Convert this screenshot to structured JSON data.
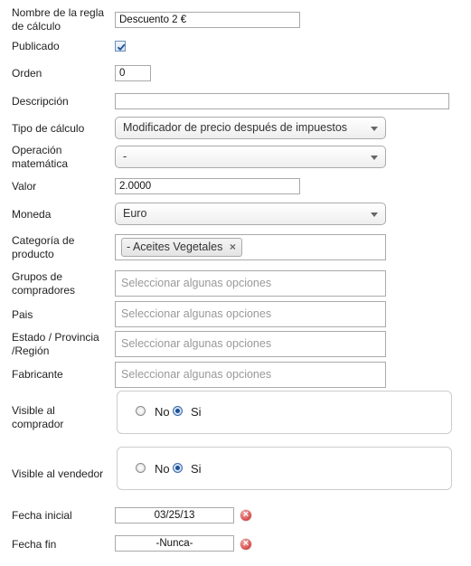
{
  "fields": {
    "nombre": {
      "label": "Nombre de la regla de cálculo",
      "value": "Descuento 2 €"
    },
    "publicado": {
      "label": "Publicado",
      "checked": true
    },
    "orden": {
      "label": "Orden",
      "value": "0"
    },
    "descripcion": {
      "label": "Descripción",
      "value": ""
    },
    "tipo_calculo": {
      "label": "Tipo de cálculo",
      "value": "Modificador de precio después de impuestos"
    },
    "operacion": {
      "label": "Operación matemática",
      "value": "-"
    },
    "valor": {
      "label": "Valor",
      "value": "2.0000"
    },
    "moneda": {
      "label": "Moneda",
      "value": "Euro"
    },
    "categoria": {
      "label": "Categoría de producto",
      "chip": "- Aceites Vegetales",
      "chip_remove": "×"
    },
    "grupos": {
      "label": "Grupos de compradores",
      "placeholder": "Seleccionar algunas opciones"
    },
    "pais": {
      "label": "Pais",
      "placeholder": "Seleccionar algunas opciones"
    },
    "estado": {
      "label": "Estado / Provincia /Región",
      "placeholder": "Seleccionar algunas opciones"
    },
    "fabricante": {
      "label": "Fabricante",
      "placeholder": "Seleccionar algunas opciones"
    },
    "visible_comprador": {
      "label": "Visible al comprador",
      "options": [
        "No",
        "Si"
      ],
      "selected": "Si"
    },
    "visible_vendedor": {
      "label": "Visible al vendedor",
      "options": [
        "No",
        "Si"
      ],
      "selected": "Si"
    },
    "fecha_inicial": {
      "label": "Fecha inicial",
      "value": "03/25/13"
    },
    "fecha_fin": {
      "label": "Fecha fin",
      "value": "-Nunca-"
    }
  },
  "icons": {
    "clear": "clear-date-icon",
    "checkbox": "checkmark-icon",
    "dropdown": "chevron-down-icon"
  },
  "colors": {
    "clear_button": "#d9534f",
    "radio_selected": "#1d4f91"
  }
}
